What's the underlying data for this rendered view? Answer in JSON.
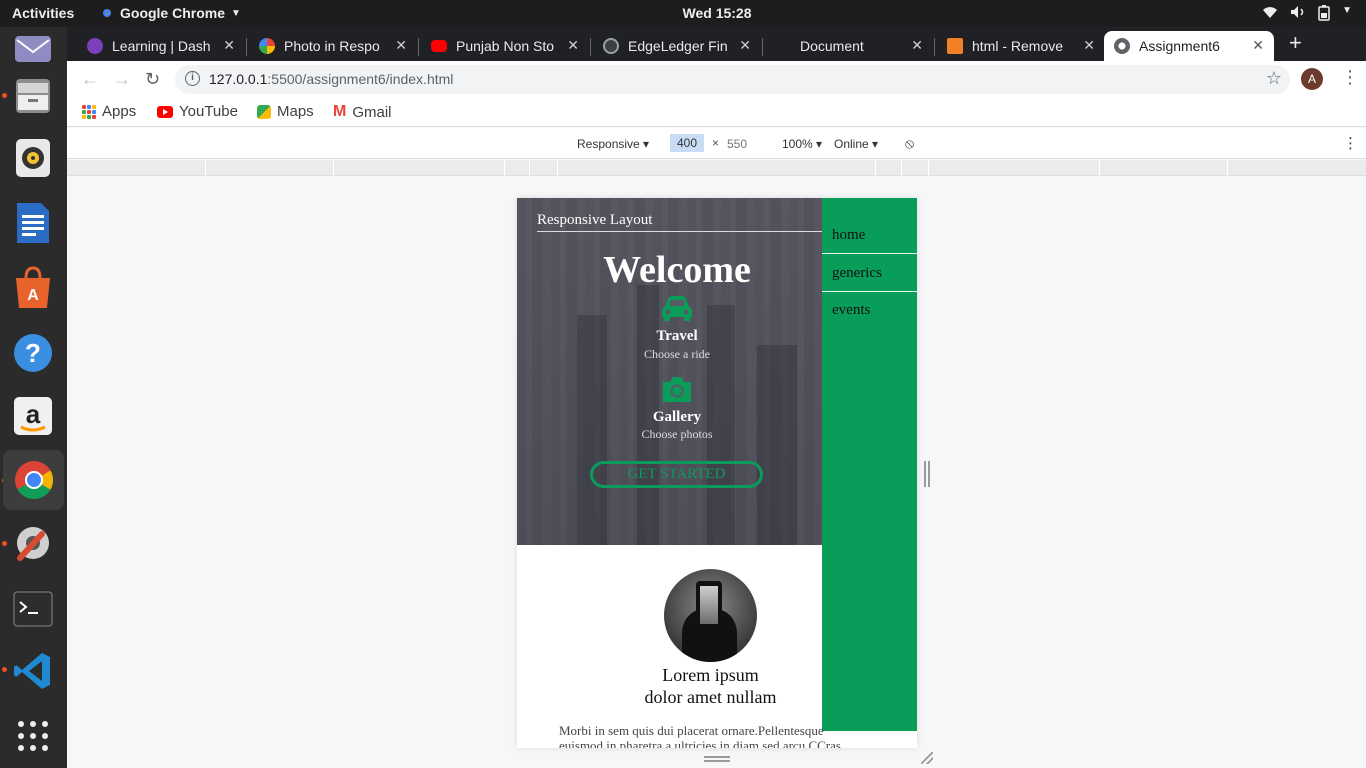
{
  "topbar": {
    "activities": "Activities",
    "app_menu": "Google Chrome",
    "clock": "Wed 15:28"
  },
  "tabs": [
    {
      "title": "Learning | Dash",
      "favicon_color": "#7b3fbd"
    },
    {
      "title": "Photo in Respo",
      "favicon_color": "#fbbc04"
    },
    {
      "title": "Punjab Non Sto",
      "favicon_color": "#ff0000"
    },
    {
      "title": "EdgeLedger Fin",
      "favicon_color": "#3c4043"
    },
    {
      "title": "Document",
      "favicon_color": "#202124"
    },
    {
      "title": "html - Remove",
      "favicon_color": "#f48024"
    },
    {
      "title": "Assignment6",
      "favicon_color": "#5f6368",
      "active": true
    }
  ],
  "omnibox": {
    "host": "127.0.0.1",
    "path": ":5500/assignment6/index.html"
  },
  "profile_initial": "A",
  "bookmarks": {
    "apps": "Apps",
    "youtube": "YouTube",
    "maps": "Maps",
    "gmail": "Gmail"
  },
  "devtools": {
    "device": "Responsive",
    "width": "400",
    "height": "550",
    "zoom": "100%",
    "network": "Online"
  },
  "page": {
    "site_title": "Responsive Layout",
    "heading": "Welcome",
    "features": [
      {
        "icon": "car-icon",
        "title": "Travel",
        "subtitle": "Choose a ride"
      },
      {
        "icon": "camera-icon",
        "title": "Gallery",
        "subtitle": "Choose photos"
      }
    ],
    "cta": "GET STARTED",
    "nav": [
      "home",
      "generics",
      "events"
    ],
    "card_title_line1": "Lorem ipsum",
    "card_title_line2": "dolor amet nullam",
    "card_body": "Morbi in sem quis dui placerat ornare.Pellentesque euismod in pharetra a ultricies in diam sed arcu CCras",
    "accent_color": "#089e5a"
  }
}
